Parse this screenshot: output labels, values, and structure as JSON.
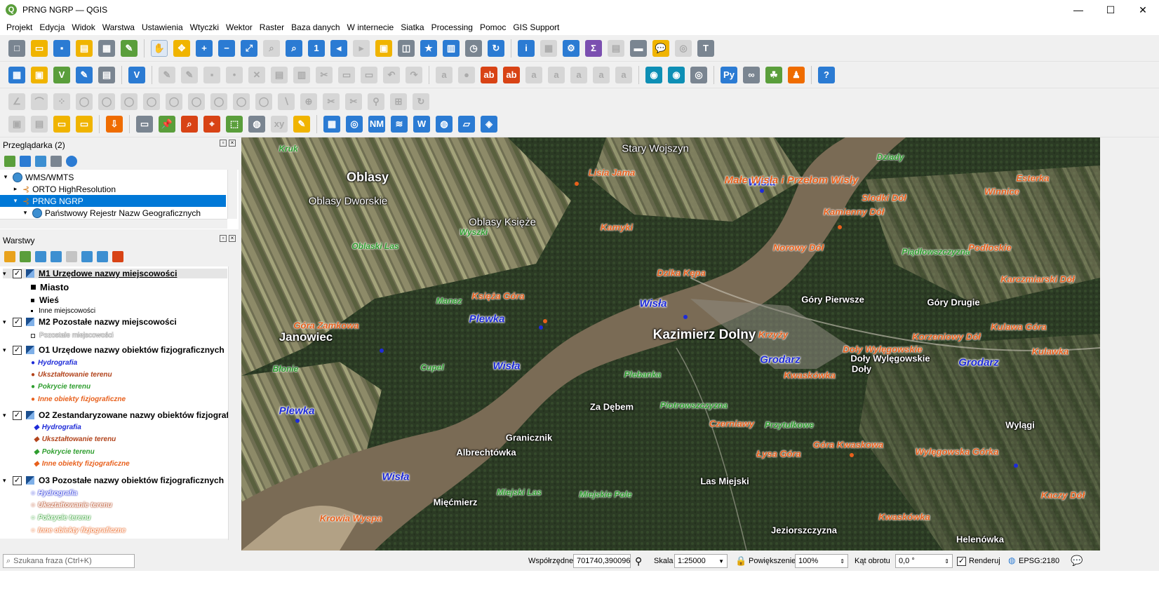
{
  "window": {
    "title": "PRNG NGRP — QGIS",
    "minimize": "—",
    "maximize": "☐",
    "close": "✕"
  },
  "menu": [
    "Projekt",
    "Edycja",
    "Widok",
    "Warstwa",
    "Ustawienia",
    "Wtyczki",
    "Wektor",
    "Raster",
    "Baza danych",
    "W internecie",
    "Siatka",
    "Processing",
    "Pomoc",
    "GIS Support"
  ],
  "browser": {
    "title": "Przeglądarka (2)",
    "items": [
      {
        "label": "WMS/WMTS"
      },
      {
        "label": "ORTO HighResolution"
      },
      {
        "label": "PRNG NGRP"
      },
      {
        "label": "Państwowy Rejestr Nazw Geograficznych"
      }
    ]
  },
  "layers": {
    "title": "Warstwy",
    "groups": [
      {
        "name": "M1 Urzędowe nazwy miejscowości",
        "items": [
          "Miasto",
          "Wieś",
          "Inne miejscowości"
        ]
      },
      {
        "name": "M2 Pozostałe nazwy miejscowości",
        "items": [
          "Pozostałe miejscowości"
        ]
      },
      {
        "name": "O1 Urzędowe nazwy obiektów fizjograficznych",
        "items": [
          "Hydrografia",
          "Ukształtowanie terenu",
          "Pokrycie terenu",
          "Inne obiekty fizjograficzne"
        ]
      },
      {
        "name": "O2 Zestandaryzowane nazwy obiektów fizjografic",
        "items": [
          "Hydrografia",
          "Ukształtowanie terenu",
          "Pokrycie terenu",
          "Inne obiekty fizjograficzne"
        ]
      },
      {
        "name": "O3 Pozostałe nazwy obiektów fizjograficznych",
        "items": [
          "Hydrografia",
          "Ukształtowanie terenu",
          "Pokrycie terenu",
          "Inne obiekty fizjograficzne"
        ]
      }
    ]
  },
  "colors": {
    "hydro": "#1e2bd8",
    "relief": "#b2441c",
    "cover": "#2f9e2f",
    "other": "#e8601c",
    "water": "#7a6b55"
  },
  "map_labels": {
    "places": [
      "Oblasy",
      "Oblasy Dworskie",
      "Oblasy Księże",
      "Stary Wojszyn",
      "Kazimierz Dolny",
      "Janowiec",
      "Góry Pierwsze",
      "Góry Drugie",
      "Doły Wylęgowskie",
      "Doły",
      "Za Dębem",
      "Granicznik",
      "Albrechtówka",
      "Las Miejski",
      "Mięćmierz",
      "Jeziorszczyzna",
      "Helenówka",
      "Wylągi"
    ],
    "hydro": [
      "Wisła",
      "Wisła",
      "Plewka",
      "Wisła",
      "Grodarz",
      "Grodarz",
      "Plewka",
      "Wisła"
    ],
    "cover": [
      "Kruk",
      "Dziady",
      "Wyszki",
      "Oblaski Las",
      "Manez",
      "Piądłowszczyzna",
      "Błonie",
      "Cupel",
      "Plebanka",
      "Piotrowszczyzna",
      "Przytułkowe",
      "Miejski Las",
      "Miejskie Pole"
    ],
    "other": [
      "Lisia Jama",
      "Małe Wisła i Przełom Wisły",
      "Esterka",
      "Słodki Dół",
      "Winnice",
      "Kamienny Dół",
      "Kamyki",
      "Norowy Dół",
      "Podłoskie",
      "Dzika Kępa",
      "Karczmiarski Dół",
      "Księża Góra",
      "Góra Zamkowa",
      "Krzyży",
      "Kulawa Góra",
      "Korzeniowy Dół",
      "Doły Wylęgowskie",
      "Kulawka",
      "Kwaskówka",
      "Czerniawy",
      "Góra Kwaskowa",
      "Łysa Góra",
      "Wylęgowska Górka",
      "Krowia Wyspa",
      "Kwaskówka",
      "Kaczy Dół"
    ]
  },
  "status": {
    "search_placeholder": "Szukana fraza (Ctrl+K)",
    "coord_label": "Współrzędne",
    "coord_value": "701740,390096",
    "scale_label": "Skala",
    "scale_value": "1:25000",
    "mag_label": "Powiększenie",
    "mag_value": "100%",
    "rot_label": "Kąt obrotu",
    "rot_value": "0,0 °",
    "render_label": "Renderuj",
    "epsg": "EPSG:2180"
  }
}
